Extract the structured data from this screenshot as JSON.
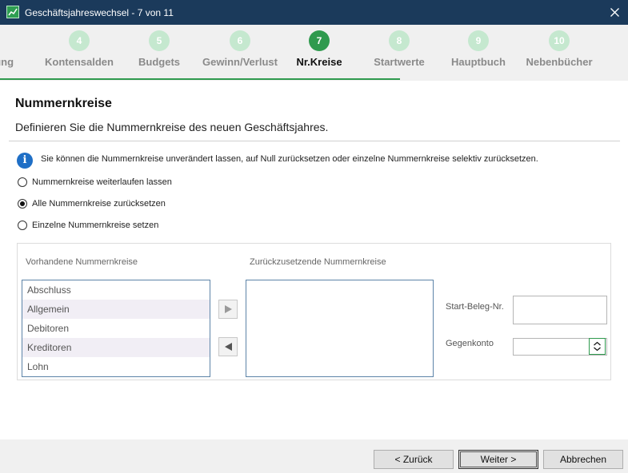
{
  "window": {
    "title": "Geschäftsjahreswechsel - 7 von 11",
    "icon": "chart-icon",
    "close_icon": "close-icon"
  },
  "stepper": {
    "active_step": 7,
    "steps": [
      {
        "number": "",
        "label": "herung"
      },
      {
        "number": "4",
        "label": "Kontensalden"
      },
      {
        "number": "5",
        "label": "Budgets"
      },
      {
        "number": "6",
        "label": "Gewinn/Verlust"
      },
      {
        "number": "7",
        "label": "Nr.Kreise"
      },
      {
        "number": "8",
        "label": "Startwerte"
      },
      {
        "number": "9",
        "label": "Hauptbuch"
      },
      {
        "number": "10",
        "label": "Nebenbücher"
      }
    ],
    "colors": {
      "active": "#2f9a4e",
      "inactive": "#c5e8cf"
    }
  },
  "page": {
    "title": "Nummernkreise",
    "description": "Definieren Sie die Nummernkreise des neuen Geschäftsjahres.",
    "info_text": "Sie können die Nummernkreise unverändert lassen, auf Null zurücksetzen oder einzelne Nummernkreise selektiv zurücksetzen."
  },
  "options": {
    "selected": "Alle Nummernkreise zurücksetzen",
    "items": [
      {
        "label": "Nummernkreise weiterlaufen lassen",
        "checked": false
      },
      {
        "label": "Alle Nummernkreise zurücksetzen",
        "checked": true
      },
      {
        "label": "Einzelne Nummernkreise setzen",
        "checked": false
      }
    ]
  },
  "available": {
    "label": "Vorhandene Nummernkreise",
    "items": [
      "Abschluss",
      "Allgemein",
      "Debitoren",
      "Kreditoren",
      "Lohn"
    ]
  },
  "to_reset": {
    "label": "Zurückzusetzende Nummernkreise",
    "items": []
  },
  "fields": {
    "start_beleg_label": "Start-Beleg-Nr.",
    "start_beleg_value": "",
    "gegenkonto_label": "Gegenkonto",
    "gegenkonto_value": ""
  },
  "footer": {
    "back_label": "< Zurück",
    "next_label": "Weiter >",
    "cancel_label": "Abbrechen"
  }
}
